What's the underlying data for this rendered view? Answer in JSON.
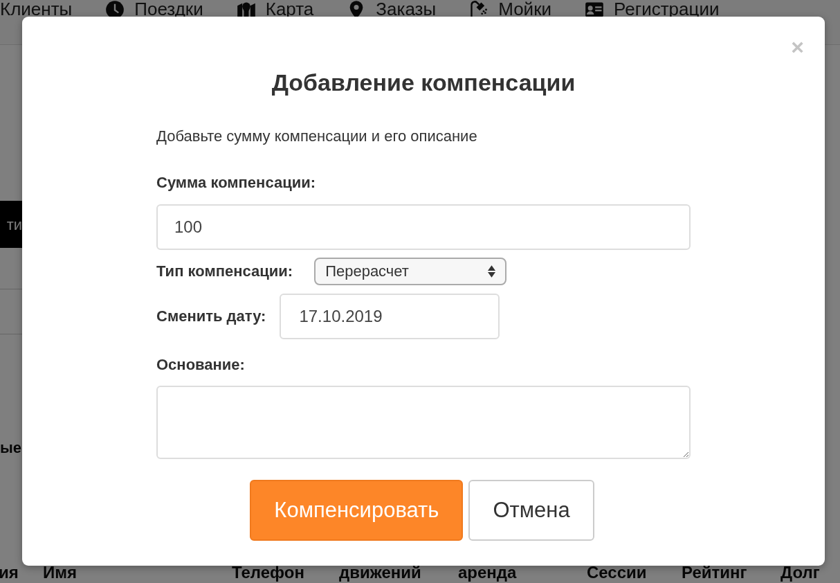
{
  "nav": {
    "items": [
      {
        "label": "Клиенты"
      },
      {
        "label": "Поездки"
      },
      {
        "label": "Карта"
      },
      {
        "label": "Заказы"
      },
      {
        "label": "Мойки"
      },
      {
        "label": "Регистрации"
      }
    ]
  },
  "sidebar": {
    "button": "ти",
    "section_title": "ые"
  },
  "table": {
    "columns": [
      "ия",
      "Имя",
      "Телефон",
      "движений",
      "аренда",
      "Сессии",
      "Рейтинг",
      "Долг"
    ]
  },
  "modal": {
    "close": "×",
    "title": "Добавление компенсации",
    "description": "Добавьте сумму компенсации и его описание",
    "fields": [
      {
        "kind": "input",
        "label": "Сумма компенсации:",
        "value": "100"
      },
      {
        "kind": "select",
        "label": "Тип компенсации:",
        "value": "Перерасчет"
      },
      {
        "kind": "date",
        "label": "Сменить дату:",
        "value": "17.10.2019"
      },
      {
        "kind": "textarea",
        "label": "Основание:"
      }
    ],
    "buttons": [
      {
        "kind": "primary",
        "label": "Компенсировать"
      },
      {
        "kind": "secondary",
        "label": "Отмена"
      }
    ]
  }
}
